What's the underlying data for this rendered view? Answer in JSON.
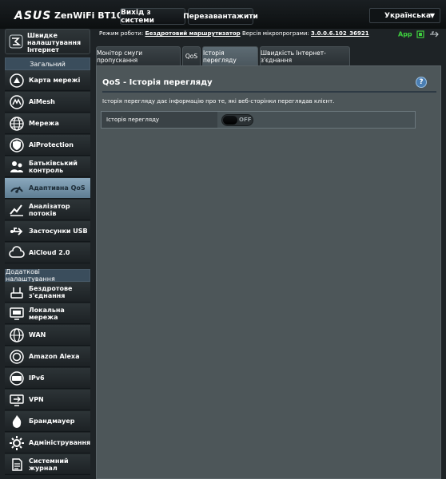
{
  "header": {
    "logo": "ASUS",
    "model": "ZenWiFi BT10",
    "logout_label": "Вихід з системи",
    "reboot_label": "Перезавантажити",
    "language": "Українська"
  },
  "sidebar": {
    "quick_setup": "Швидке налаштування Інтернет",
    "general_title": "Загальний",
    "general_items": [
      {
        "label": "Карта мережі",
        "icon": "network-map-icon"
      },
      {
        "label": "AiMesh",
        "icon": "aimesh-icon"
      },
      {
        "label": "Мережа",
        "icon": "network-globe-icon"
      },
      {
        "label": "AiProtection",
        "icon": "aiprotection-shield-icon"
      },
      {
        "label": "Батьківський контроль",
        "icon": "parental-control-icon"
      },
      {
        "label": "Адаптивна QoS",
        "icon": "adaptive-qos-icon"
      },
      {
        "label": "Аналізатор потоків",
        "icon": "traffic-analyzer-icon"
      },
      {
        "label": "Застосунки USB",
        "icon": "usb-icon"
      },
      {
        "label": "AiCloud 2.0",
        "icon": "aicloud-icon"
      }
    ],
    "active_index": 5,
    "advanced_title": "Додаткові налаштування",
    "advanced_items": [
      {
        "label": "Бездротове з'єднання",
        "icon": "wireless-icon"
      },
      {
        "label": "Локальна мережа",
        "icon": "lan-icon"
      },
      {
        "label": "WAN",
        "icon": "wan-globe-icon"
      },
      {
        "label": "Amazon Alexa",
        "icon": "alexa-icon"
      },
      {
        "label": "IPv6",
        "icon": "ipv6-icon"
      },
      {
        "label": "VPN",
        "icon": "vpn-icon"
      },
      {
        "label": "Брандмауер",
        "icon": "firewall-icon"
      },
      {
        "label": "Адміністрування",
        "icon": "administration-icon"
      },
      {
        "label": "Системний журнал",
        "icon": "system-log-icon"
      }
    ]
  },
  "status": {
    "mode_label": "Режим роботи:",
    "mode_value": "Бездротовий маршрутизатор",
    "fw_label": "Версія мікропрограми:",
    "fw_value": "3.0.0.6.102_36921",
    "app_label": "App"
  },
  "tabs": [
    "Монітор смуги пропускання",
    "QoS",
    "Історія перегляду",
    "Швидкість Інтернет-з'єднання"
  ],
  "active_tab": 2,
  "panel": {
    "title": "QoS - Історія перегляду",
    "help": "?",
    "description": "Історія перегляду дає інформацію про те, які веб-сторінки переглядав клієнт.",
    "setting_label": "Історія перегляду",
    "toggle_state": "OFF"
  },
  "colors": {
    "background": "#1e2326",
    "panel": "#4d5659",
    "active_menu": "#7b98ad",
    "app_green": "#3fd03f"
  }
}
